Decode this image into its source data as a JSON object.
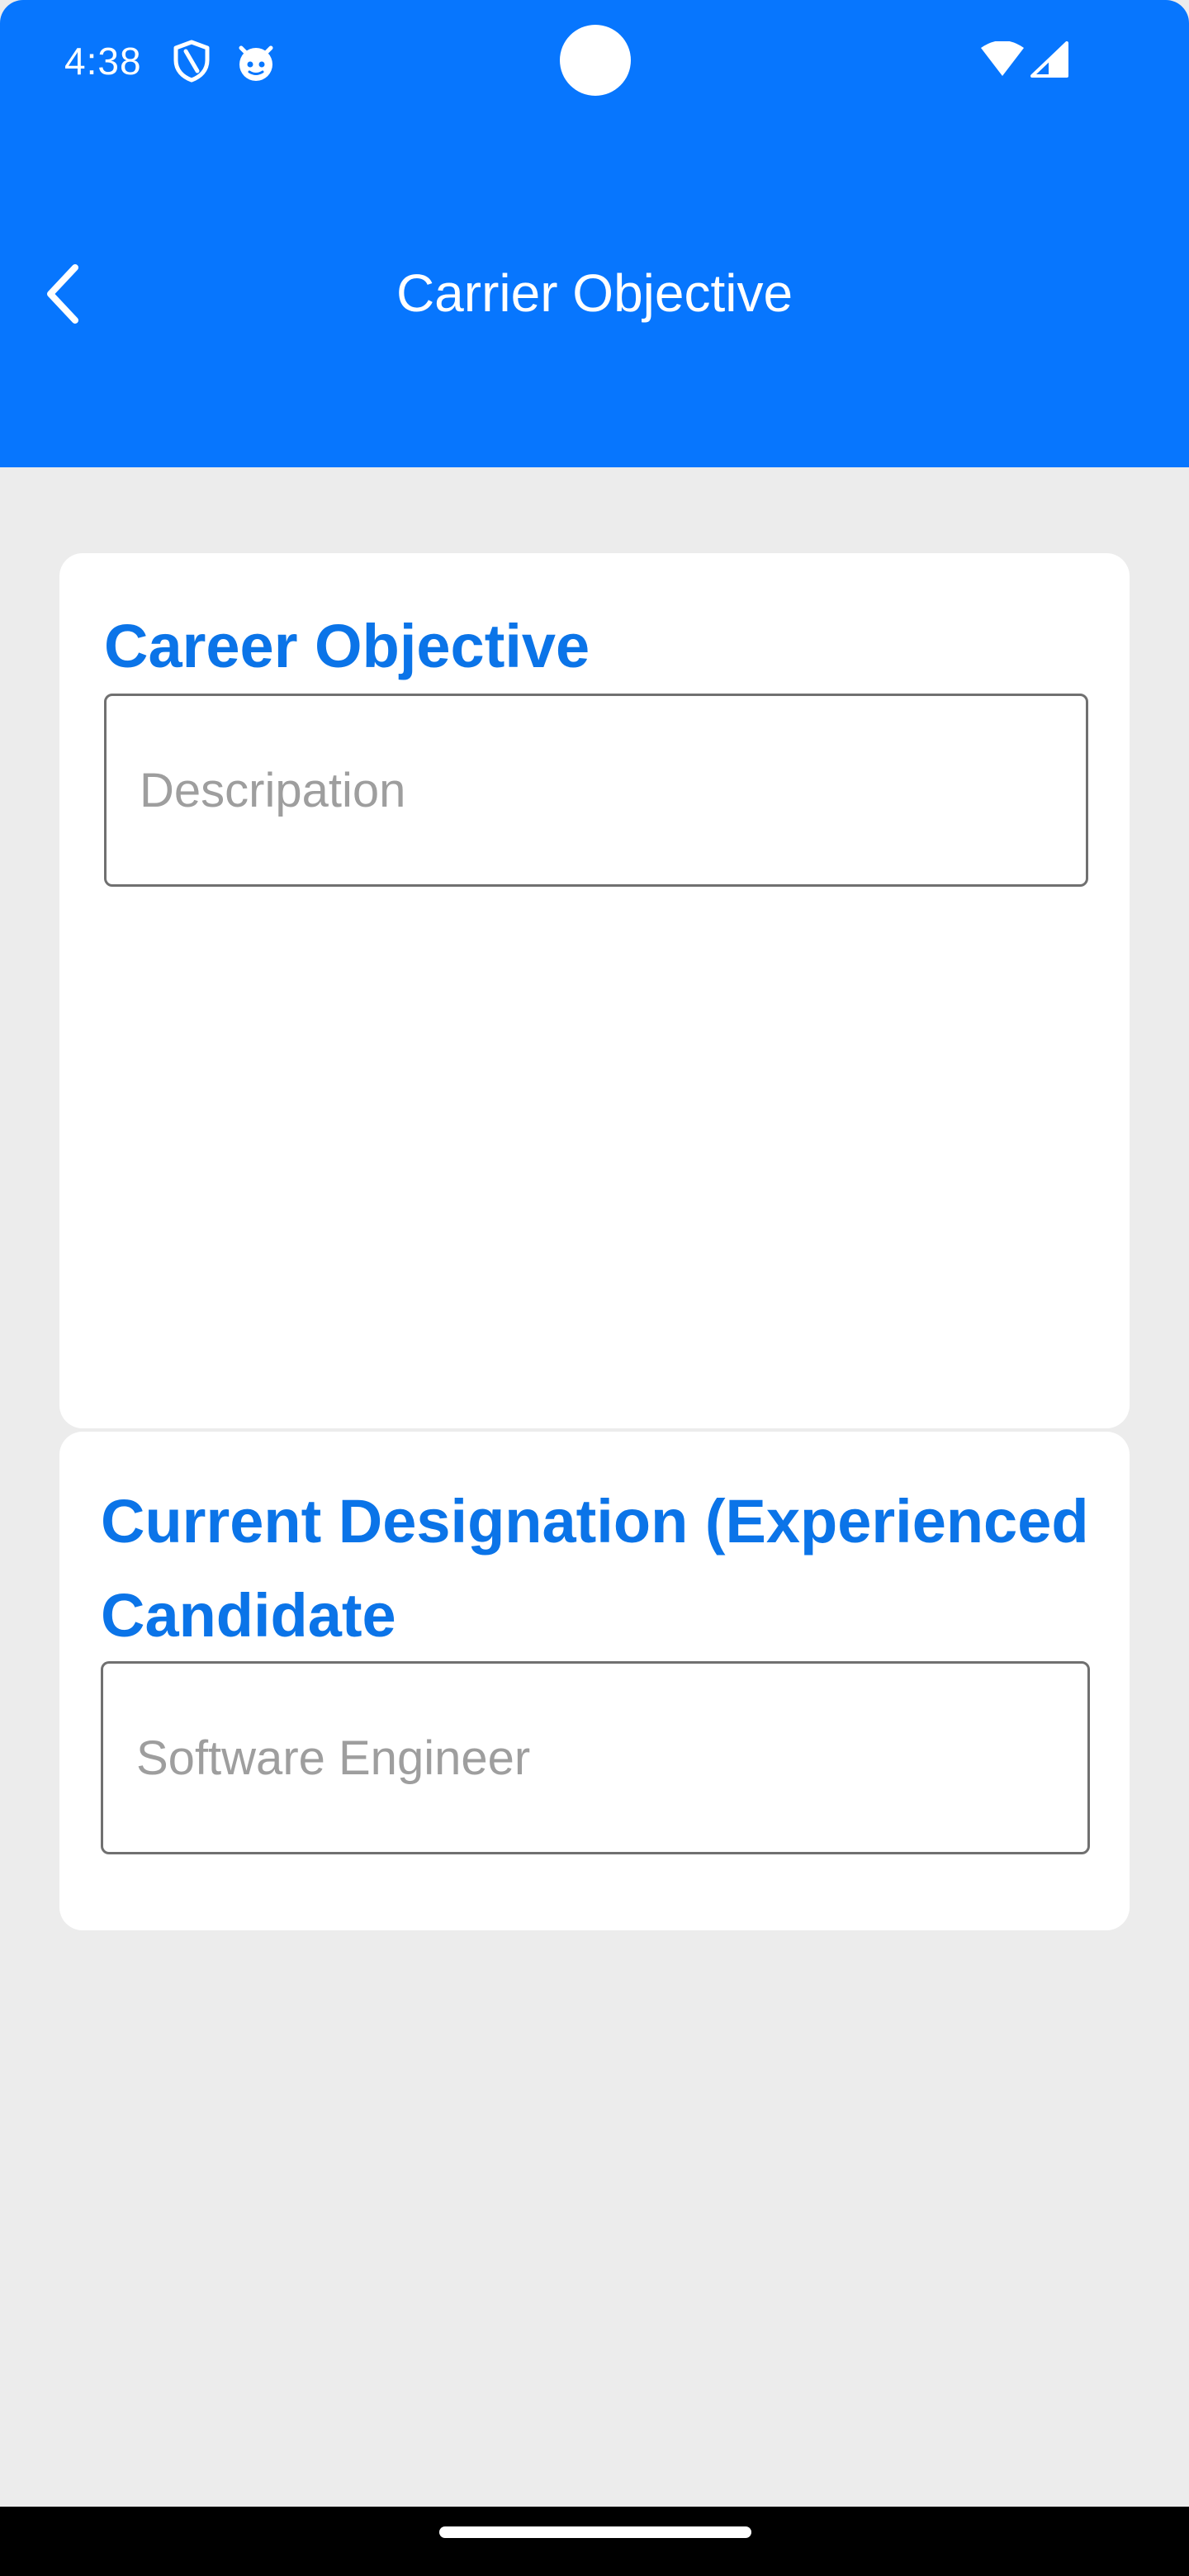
{
  "status_bar": {
    "time": "4:38",
    "icons": [
      "shield-icon",
      "android-debug-icon",
      "wifi-icon",
      "cellular-signal-icon"
    ]
  },
  "header": {
    "title": "Carrier Objective",
    "back_icon": "chevron-left-icon"
  },
  "career_section": {
    "title": "Career Objective",
    "description_placeholder": "Descripation",
    "description_value": ""
  },
  "designation_section": {
    "title": "Current Designation (Experienced Candidate",
    "designation_placeholder": "Software Engineer",
    "designation_value": ""
  },
  "colors": {
    "app_bar": "#0776fe",
    "section_title": "#0b74e8",
    "background": "#ececec",
    "card": "#ffffff"
  }
}
